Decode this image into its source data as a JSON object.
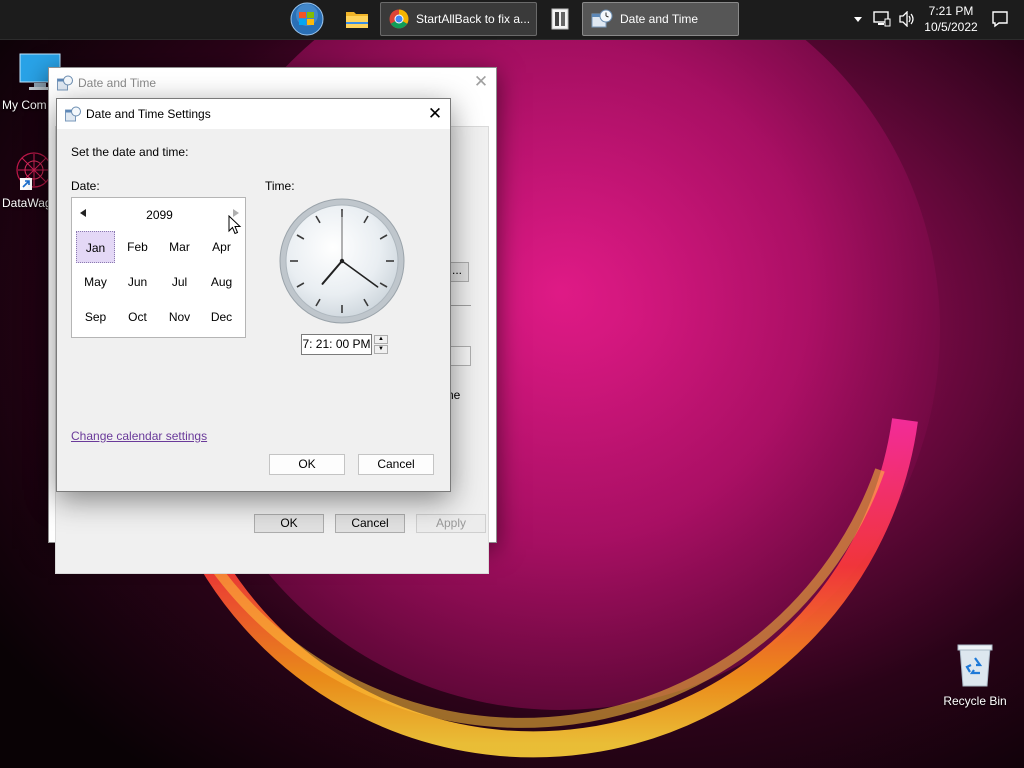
{
  "taskbar": {
    "tasks": [
      {
        "label": "StartAllBack to fix a..."
      },
      {
        "label": "Date and Time"
      }
    ],
    "clock": {
      "time": "7:21 PM",
      "date": "10/5/2022"
    }
  },
  "desktop": {
    "icons": [
      {
        "label": "My Com"
      },
      {
        "label": "DataWag"
      },
      {
        "label": "Recycle Bin"
      }
    ]
  },
  "back_window": {
    "title": "Date and Time",
    "ok_label": "OK",
    "cancel_label": "Cancel",
    "apply_label": "Apply",
    "fragment_ellipsis": "...",
    "fragment_text": "ne"
  },
  "dialog": {
    "title": "Date and Time Settings",
    "heading": "Set the date and time:",
    "date_label": "Date:",
    "time_label": "Time:",
    "calendar": {
      "year": "2099",
      "months": [
        "Jan",
        "Feb",
        "Mar",
        "Apr",
        "May",
        "Jun",
        "Jul",
        "Aug",
        "Sep",
        "Oct",
        "Nov",
        "Dec"
      ],
      "selected_month": "Jan"
    },
    "time_value": "7: 21: 00 PM",
    "clock_face": {
      "hour": 7,
      "minute": 21,
      "second": 0
    },
    "change_calendar_link": "Change calendar settings",
    "ok_label": "OK",
    "cancel_label": "Cancel"
  },
  "colors": {
    "selection": "#e4d8f6",
    "link": "#6a3a9a",
    "taskbar": "#1c1c1c"
  }
}
